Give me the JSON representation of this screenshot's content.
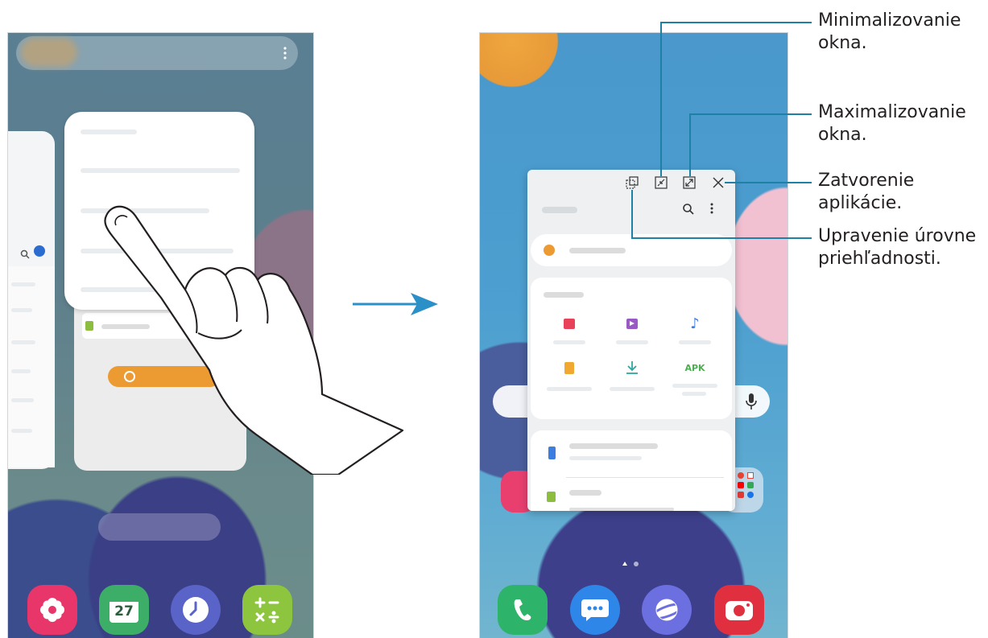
{
  "left_phone": {
    "dock_apps": [
      {
        "name": "Bixby Home",
        "icon": "flower-icon",
        "color": "#e8366a"
      },
      {
        "name": "Calendar",
        "icon": "calendar-icon",
        "label": "27",
        "color": "#3dae67"
      },
      {
        "name": "Clock",
        "icon": "clock-icon",
        "color": "#5a63c7"
      },
      {
        "name": "Calculator",
        "icon": "calculator-icon",
        "color": "#8dc53e"
      }
    ]
  },
  "right_phone": {
    "popup": {
      "category_icons": [
        "image-icon",
        "video-icon",
        "audio-icon",
        "document-icon",
        "download-icon",
        "apk-icon"
      ],
      "apk_label": "APK"
    },
    "dock_apps": [
      {
        "name": "Phone",
        "icon": "phone-icon",
        "color": "#2eb36a"
      },
      {
        "name": "Messages",
        "icon": "messages-icon",
        "color": "#2e86e8"
      },
      {
        "name": "Internet",
        "icon": "internet-icon",
        "color": "#6b6fe0"
      },
      {
        "name": "Camera",
        "icon": "camera-icon",
        "color": "#e0303f"
      }
    ]
  },
  "callouts": [
    {
      "line1": "Minimalizovanie",
      "line2": "okna."
    },
    {
      "line1": "Maximalizovanie",
      "line2": "okna."
    },
    {
      "line1": "Zatvorenie",
      "line2": "aplikácie."
    },
    {
      "line1": "Upravenie úrovne",
      "line2": "priehľadnosti."
    }
  ],
  "colors": {
    "accent": "#1f80a6",
    "arrow": "#2b8fc8",
    "window_bg": "#eef0f2"
  }
}
